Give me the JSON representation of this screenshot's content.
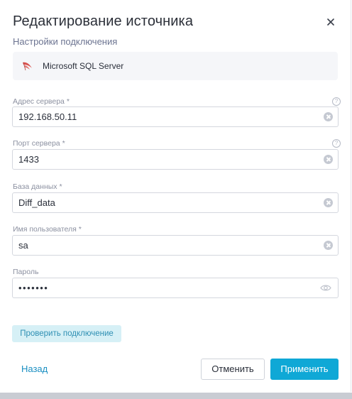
{
  "dialog": {
    "title": "Редактирование источника",
    "subtitle": "Настройки подключения",
    "source_name": "Microsoft SQL Server"
  },
  "fields": {
    "server_address": {
      "label": "Адрес сервера",
      "required_mark": "*",
      "value": "192.168.50.11",
      "help": "?"
    },
    "server_port": {
      "label": "Порт сервера",
      "required_mark": "*",
      "value": "1433",
      "help": "?"
    },
    "database": {
      "label": "База данных",
      "required_mark": "*",
      "value": "Diff_data"
    },
    "username": {
      "label": "Имя пользователя",
      "required_mark": "*",
      "value": "sa"
    },
    "password": {
      "label": "Пароль",
      "value": "•••••••"
    }
  },
  "buttons": {
    "check_connection": "Проверить подключение",
    "back": "Назад",
    "cancel": "Отменить",
    "apply": "Применить"
  },
  "icons": {
    "close": "close-icon",
    "logo": "sql-server-logo-icon",
    "clear": "clear-icon",
    "eye": "eye-icon",
    "help": "help-icon"
  },
  "colors": {
    "accent": "#0fa8d6",
    "link": "#1a8fc2",
    "check_button_bg": "#d6f0f6",
    "logo_red": "#d9534f"
  }
}
